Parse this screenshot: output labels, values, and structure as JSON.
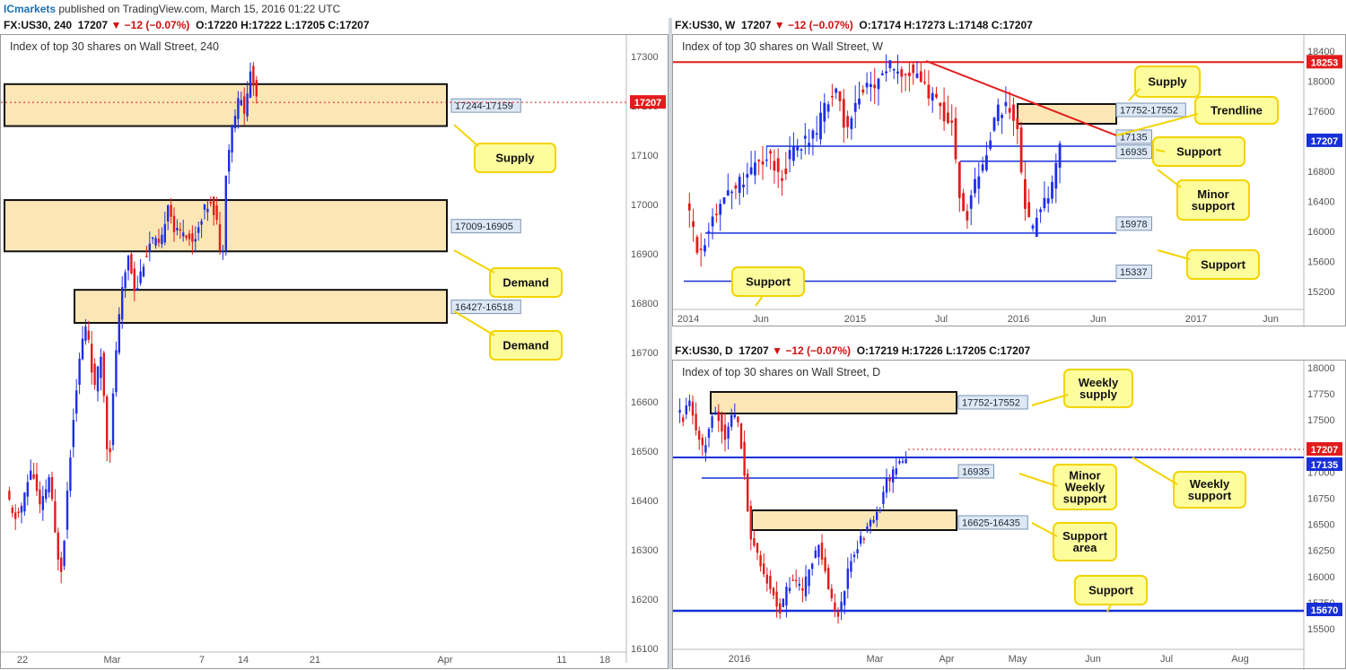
{
  "header": {
    "brand": "ICmarkets",
    "published": " published on TradingView.com, March 15, 2016 01:22 UTC"
  },
  "colors": {
    "bull": "#1e2ee8",
    "bear": "#e31b1b",
    "zone_fill": "#fbe7b5",
    "zone_border": "#111111",
    "level_line": "#1730d8",
    "callout_fill": "#fdfd9e",
    "callout_border": "#f2d400",
    "tag_fill": "#dde8f4",
    "price_red": "#e31b1b",
    "price_blue": "#1730d8",
    "trendline": "#e31b1b"
  },
  "panels": [
    {
      "id": "h4",
      "symbol_line": {
        "sym": "FX:US30, 240",
        "price": "17207",
        "change": "−12 (−0.07%)",
        "ohlc": "O:17220 H:17222 L:17205 C:17207"
      },
      "title": "Index of top 30 shares on Wall Street, 240",
      "current_price": "17207",
      "x_ticks": [
        "22",
        "Mar",
        "7",
        "14",
        "21",
        "Apr",
        "11",
        "18"
      ],
      "y_ticks": [
        "17300",
        "17200",
        "17100",
        "17000",
        "16900",
        "16800",
        "16700",
        "16600",
        "16500",
        "16400",
        "16300",
        "16200",
        "16100"
      ],
      "zones": [
        {
          "label": "17244-17159",
          "top": 17244,
          "bottom": 17159
        },
        {
          "label": "17009-16905",
          "top": 17009,
          "bottom": 16905
        },
        {
          "label": "16427-16518",
          "top": 16827,
          "bottom": 16760
        }
      ],
      "callouts": [
        "Supply",
        "Demand",
        "Demand"
      ]
    },
    {
      "id": "weekly",
      "symbol_line": {
        "sym": "FX:US30, W",
        "price": "17207",
        "change": "−12 (−0.07%)",
        "ohlc": "O:17174 H:17273 L:17148 C:17207"
      },
      "title": "Index of top 30 shares on Wall Street, W",
      "current_price": "17207",
      "red_level": "18253",
      "x_ticks": [
        "2014",
        "Jun",
        "2015",
        "Jul",
        "2016",
        "Jun",
        "2017",
        "Jun"
      ],
      "y_ticks": [
        "18400",
        "18000",
        "17600",
        "17200",
        "16800",
        "16400",
        "16000",
        "15600",
        "15200"
      ],
      "zones": [
        {
          "label": "17752-17552"
        }
      ],
      "levels": [
        {
          "label": "17135",
          "value": 17135
        },
        {
          "label": "16935",
          "value": 16935
        },
        {
          "label": "15978",
          "value": 15978
        },
        {
          "label": "15337",
          "value": 15337
        }
      ],
      "callouts": [
        "Supply",
        "Trendline",
        "Support",
        "Minor support",
        "Support",
        "Support"
      ]
    },
    {
      "id": "daily",
      "symbol_line": {
        "sym": "FX:US30, D",
        "price": "17207",
        "change": "−12 (−0.07%)",
        "ohlc": "O:17219 H:17226 L:17205 C:17207"
      },
      "title": "Index of top 30 shares on Wall Street, D",
      "current_price": "17207",
      "level_price": "17135",
      "support_price": "15670",
      "x_ticks": [
        "2016",
        "Mar",
        "Apr",
        "May",
        "Jun",
        "Jul",
        "Aug"
      ],
      "y_ticks": [
        "18000",
        "17750",
        "17500",
        "17250",
        "17000",
        "16750",
        "16500",
        "16250",
        "16000",
        "15750",
        "15500"
      ],
      "zones": [
        {
          "label": "17752-17552"
        },
        {
          "label": "16625-16435"
        }
      ],
      "levels": [
        {
          "label": "16935"
        }
      ],
      "callouts": [
        "Weekly supply",
        "Minor Weekly support",
        "Weekly support",
        "Support area",
        "Support"
      ]
    }
  ]
}
